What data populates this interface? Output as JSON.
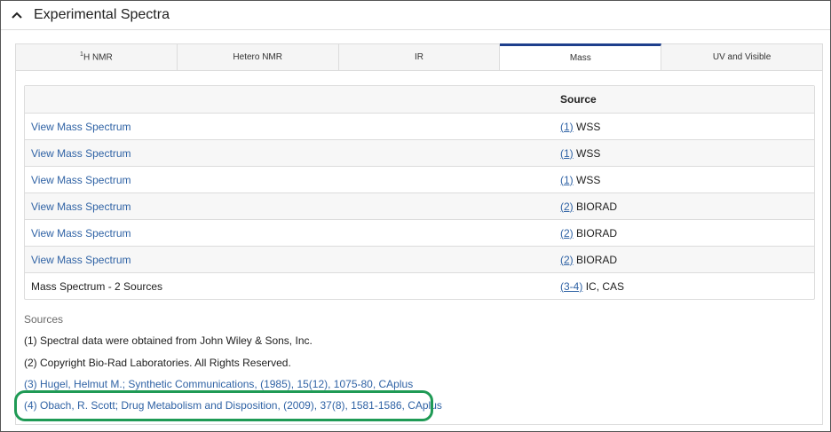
{
  "section": {
    "title": "Experimental Spectra"
  },
  "tabs": [
    {
      "sup": "1",
      "label": "H NMR"
    },
    {
      "sup": "",
      "label": "Hetero NMR"
    },
    {
      "sup": "",
      "label": "IR"
    },
    {
      "sup": "",
      "label": "Mass"
    },
    {
      "sup": "",
      "label": "UV and Visible"
    }
  ],
  "table": {
    "header": {
      "col1": "",
      "col2": "Source"
    },
    "rows": [
      {
        "label": "View Mass Spectrum",
        "ref": "(1)",
        "src": "WSS"
      },
      {
        "label": "View Mass Spectrum",
        "ref": "(1)",
        "src": "WSS"
      },
      {
        "label": "View Mass Spectrum",
        "ref": "(1)",
        "src": "WSS"
      },
      {
        "label": "View Mass Spectrum",
        "ref": "(2)",
        "src": "BIORAD"
      },
      {
        "label": "View Mass Spectrum",
        "ref": "(2)",
        "src": "BIORAD"
      },
      {
        "label": "View Mass Spectrum",
        "ref": "(2)",
        "src": "BIORAD"
      },
      {
        "label": "Mass Spectrum - 2 Sources",
        "ref": "(3-4)",
        "src": "IC, CAS"
      }
    ]
  },
  "sources": {
    "label": "Sources",
    "items": [
      "(1) Spectral data were obtained from John Wiley & Sons, Inc.",
      "(2) Copyright Bio-Rad Laboratories. All Rights Reserved.",
      "(3) Hugel, Helmut M.; Synthetic Communications, (1985), 15(12), 1075-80, CAplus",
      "(4) Obach, R. Scott; Drug Metabolism and Disposition, (2009), 37(8), 1581-1586, CAplus"
    ]
  },
  "colors": {
    "link": "#3063a5",
    "active_tab": "#1e3f8c",
    "highlight": "#1f9a55"
  }
}
